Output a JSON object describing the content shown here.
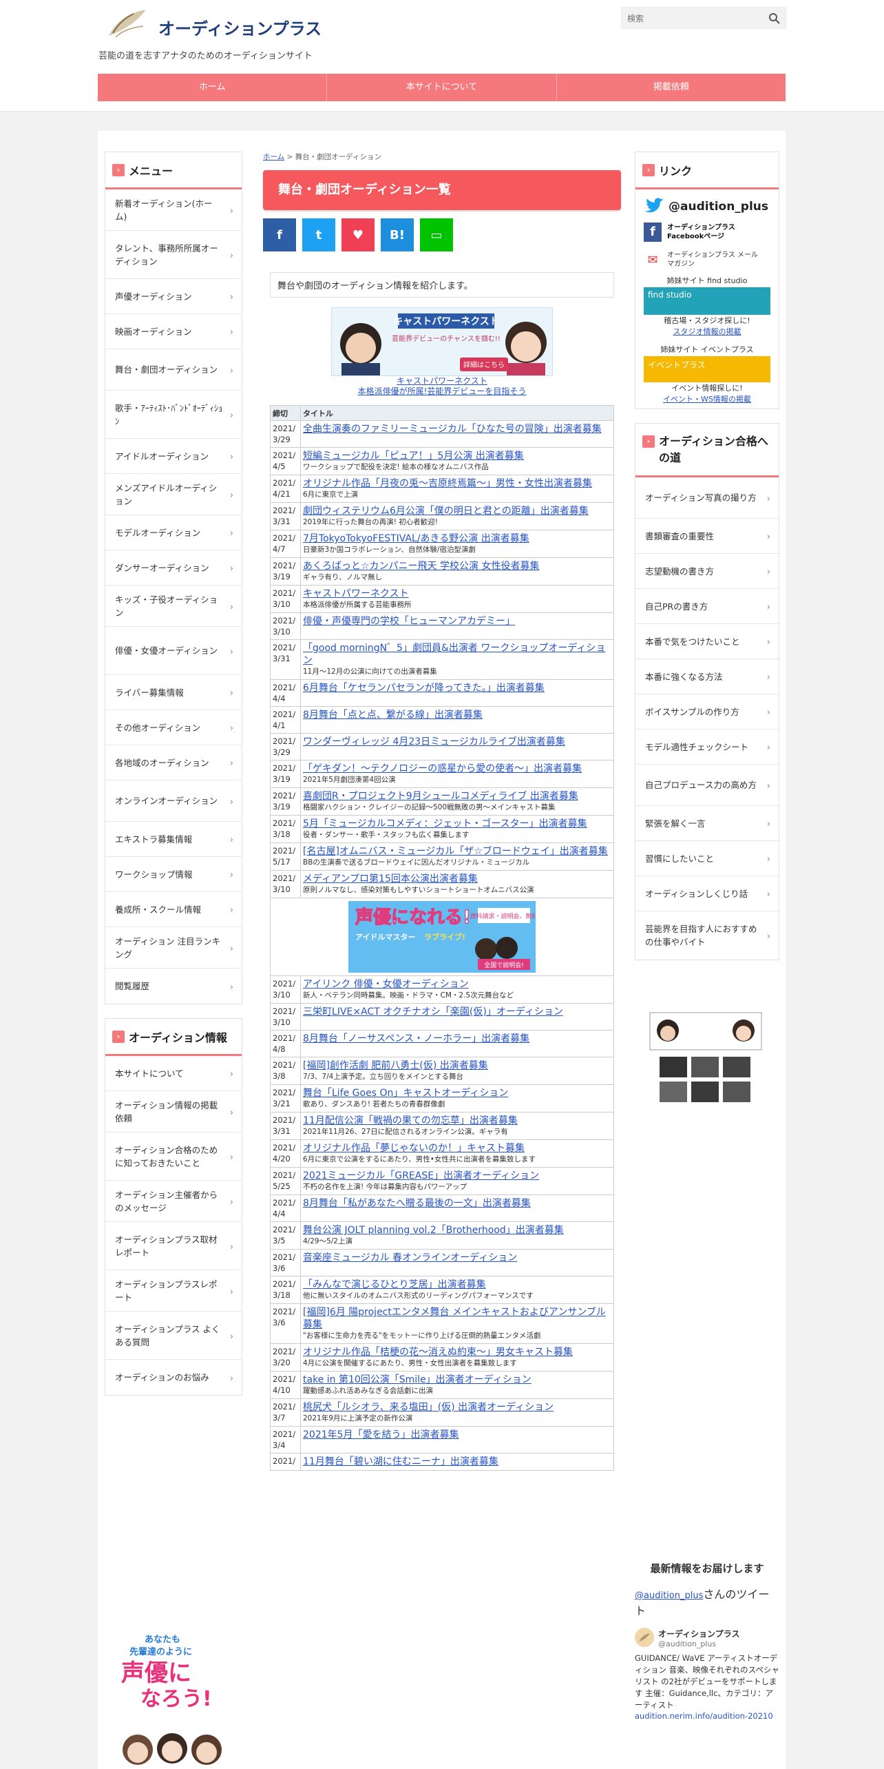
{
  "site": {
    "logo_text": "オーディションプラス",
    "tagline": "芸能の道を志すアナタのためのオーディションサイト",
    "search_placeholder": "検索"
  },
  "nav": [
    "ホーム",
    "本サイトについて",
    "掲載依頼"
  ],
  "breadcrumb": {
    "home": "ホーム",
    "sep": ">",
    "current": "舞台・劇団オーディション"
  },
  "page_title": "舞台・劇団オーディション一覧",
  "share": [
    {
      "name": "facebook",
      "glyph": "f",
      "color": "#2e5fa6"
    },
    {
      "name": "twitter",
      "glyph": "t",
      "color": "#1da1f2"
    },
    {
      "name": "pocket",
      "glyph": "♥",
      "color": "#ef4056"
    },
    {
      "name": "hatena",
      "glyph": "B!",
      "color": "#1e8fdf"
    },
    {
      "name": "line",
      "glyph": "▭",
      "color": "#00c300"
    }
  ],
  "intro": "舞台や劇団のオーディション情報を紹介します。",
  "banner1": {
    "title": "キャストパワーネクスト",
    "sub": "芸能界デビューのチャンスを掴む!!",
    "button": "詳細はこちら",
    "caption1": "キャストパワーネクスト",
    "caption2": "本格派俳優が所属!芸能界デビューを目指そう"
  },
  "table": {
    "col_date": "締切",
    "col_title": "タイトル"
  },
  "jobs": [
    {
      "date": "2021/3/29",
      "title": "全曲生演奏のファミリーミュージカル「ひなた号の冒険」出演者募集",
      "sub": ""
    },
    {
      "date": "2021/4/5",
      "title": "短編ミュージカル「ピュア！」5月公演 出演者募集",
      "sub": "ワークショップで配役を決定! 絵本の様なオムニバス作品"
    },
    {
      "date": "2021/4/21",
      "title": "オリジナル作品「月夜の兎～吉原終焉篇～」男性・女性出演者募集",
      "sub": "6月に東京で上演"
    },
    {
      "date": "2021/3/31",
      "title": "劇団ウィステリウム6月公演「僕の明日と君との距離」出演者募集",
      "sub": "2019年に行った舞台の再演! 初心者歓迎!"
    },
    {
      "date": "2021/4/7",
      "title": "7月TokyoTokyoFESTIVAL/あきる野公演 出演者募集",
      "sub": "日豪新3か国コラボレーション、自然体験/宿泊型演劇"
    },
    {
      "date": "2021/3/19",
      "title": "あくろばっと☆カンパニー飛天 学校公演 女性役者募集",
      "sub": "ギャラ有り、ノルマ無し"
    },
    {
      "date": "2021/3/10",
      "title": "キャストパワーネクスト",
      "sub": "本格派俳優が所属する芸能事務所"
    },
    {
      "date": "2021/3/10",
      "title": "俳優・声優専門の学校「ヒューマンアカデミー」",
      "sub": ""
    },
    {
      "date": "2021/3/31",
      "title": "「good morningN゛5」劇団員&出演者 ワークショップオーディション",
      "sub": "11月～12月の公演に向けての出演者募集"
    },
    {
      "date": "2021/4/4",
      "title": "6月舞台「ケセランパセランが降ってきた。」出演者募集",
      "sub": ""
    },
    {
      "date": "2021/4/1",
      "title": "8月舞台「点と点、繋がる線」出演者募集",
      "sub": ""
    },
    {
      "date": "2021/3/29",
      "title": "ワンダーヴィレッジ 4月23日ミュージカルライブ出演者募集",
      "sub": ""
    },
    {
      "date": "2021/3/19",
      "title": "「ゲキダン！～テクノロジーの惑星から愛の使者～」出演者募集",
      "sub": "2021年5月劇団湊第4回公演"
    },
    {
      "date": "2021/3/19",
      "title": "喜劇団R・プロジェクト9月シュールコメディライブ 出演者募集",
      "sub": "格闘家ハクション・クレイジーの記録～500戦無敗の男～メインキャスト募集"
    },
    {
      "date": "2021/3/18",
      "title": "5月「ミュージカルコメディ：ジェット・ゴースター」出演者募集",
      "sub": "役者・ダンサー・歌手・スタッフも広く募集します"
    },
    {
      "date": "2021/5/17",
      "title": "[名古屋]オムニバス・ミュージカル「ザ☆ブロードウェイ」出演者募集",
      "sub": "BBの生演奏で送るブロードウェイに因んだオリジナル・ミュージカル"
    },
    {
      "date": "2021/3/10",
      "title": "メディアンプロ第15回本公演出演者募集",
      "sub": "原則ノルマなし、感染対策もしやすいショートショートオムニバス公演"
    }
  ],
  "banner2": {
    "line1": "声優になれる!",
    "line2": "資料請求・説明会、無料",
    "line3": "アイドルマスター",
    "line4": "ラブライブ!",
    "line5": "全国で説明会!"
  },
  "jobs2": [
    {
      "date": "2021/3/10",
      "title": "アイリンク 俳優・女優オーディション",
      "sub": "新人・ベテラン同時募集。映画・ドラマ・CM・2.5次元舞台など"
    },
    {
      "date": "2021/3/10",
      "title": "三栄町LIVE×ACT オクチナオシ「楽園(仮)」オーディション",
      "sub": ""
    },
    {
      "date": "2021/4/8",
      "title": "8月舞台「ノーサスペンス・ノーホラー」出演者募集",
      "sub": ""
    },
    {
      "date": "2021/3/8",
      "title": "[福岡]創作活劇 肥前八勇士(仮) 出演者募集",
      "sub": "7/3、7/4上演予定。立ち回りをメインとする舞台"
    },
    {
      "date": "2021/3/21",
      "title": "舞台「Life Goes On」キャストオーディション",
      "sub": "歌あり、ダンスあり! 若者たちの青春群像劇"
    },
    {
      "date": "2021/3/31",
      "title": "11月配信公演「戦禍の果ての勿忘草」出演者募集",
      "sub": "2021年11月26、27日に配信されるオンライン公演。ギャラ有"
    },
    {
      "date": "2021/4/20",
      "title": "オリジナル作品「夢じゃないのか！」キャスト募集",
      "sub": "6月に東京で公演をするにあたり、男性•女性共に出演者を募集致します"
    },
    {
      "date": "2021/5/25",
      "title": "2021ミュージカル「GREASE」出演者オーディション",
      "sub": "不朽の名作を上演! 今年は募集内容もパワーアップ"
    },
    {
      "date": "2021/4/4",
      "title": "8月舞台「私があなたへ贈る最後の一文」出演者募集",
      "sub": ""
    },
    {
      "date": "2021/3/5",
      "title": "舞台公演 JOLT planning vol.2「Brotherhood」出演者募集",
      "sub": "4/29～5/2上演"
    },
    {
      "date": "2021/3/6",
      "title": "音楽座ミュージカル 春オンラインオーディション",
      "sub": ""
    },
    {
      "date": "2021/3/18",
      "title": "「みんなで演じるひとり芝居」出演者募集",
      "sub": "他に無いスタイルのオムニバス形式のリーディングパフォーマンスです"
    },
    {
      "date": "2021/3/6",
      "title": "[福岡]6月 陽projectエンタメ舞台 メインキャストおよびアンサンブル募集",
      "sub": "\"お客様に生命力を売る\"をモットーに作り上げる圧倒的熱量エンタメ活劇"
    },
    {
      "date": "2021/3/20",
      "title": "オリジナル作品「桔梗の花～消えぬ約束～」男女キャスト募集",
      "sub": "4月に公演を開催するにあたり、男性・女性出演者を募集致します"
    },
    {
      "date": "2021/4/10",
      "title": "take in 第10回公演「Smile」出演者オーディション",
      "sub": "躍動感あふれ活あみなぎる会話劇に出演"
    },
    {
      "date": "2021/3/7",
      "title": "桃尻犬「ルシオラ、来る塩田」(仮) 出演者オーディション",
      "sub": "2021年9月に上演予定の新作公演"
    },
    {
      "date": "2021/3/4",
      "title": "2021年5月「愛を結う」出演者募集",
      "sub": ""
    },
    {
      "date": "2021/",
      "title": "11月舞台「碧い湖に住むニーナ」出演者募集",
      "sub": ""
    }
  ],
  "left_menu": {
    "title": "メニュー",
    "items": [
      "新着オーディション(ホーム)",
      "タレント、事務所所属オーディション",
      "声優オーディション",
      "映画オーディション",
      "舞台・劇団オーディション",
      "歌手・ｱｰﾃｨｽﾄ･ﾊﾞﾝﾄﾞｵｰﾃﾞｨｼｮﾝ",
      "アイドルオーディション",
      "メンズアイドルオーディション",
      "モデルオーディション",
      "ダンサーオーディション",
      "キッズ・子役オーディション",
      "俳優・女優オーディション",
      "ライバー募集情報",
      "その他オーディション",
      "各地域のオーディション",
      "オンラインオーディション",
      "エキストラ募集情報",
      "ワークショップ情報",
      "養成所・スクール情報",
      "オーディション 注目ランキング",
      "閲覧履歴"
    ]
  },
  "left_info": {
    "title": "オーディション情報",
    "items": [
      "本サイトについて",
      "オーディション情報の掲載依頼",
      "オーディション合格のために知っておきたいこと",
      "オーディション主催者からのメッセージ",
      "オーディションプラス取材レポート",
      "オーディションプラスレポート",
      "オーディションプラス よくある質問",
      "オーディションのお悩み"
    ]
  },
  "left_ad": {
    "line1": "あなたも",
    "line2": "先輩達のように",
    "line3": "声優に",
    "line4": "なろう!"
  },
  "links": {
    "title": "リンク",
    "twitter_handle": "@audition_plus",
    "fb_label": "オーディションプラス Facebookページ",
    "mail_label": "オーディションプラス メールマガジン",
    "find_title": "姉妹サイト find studio",
    "find_banner": "find studio",
    "find_desc": "稽古場・スタジオ探しに!",
    "find_link": "スタジオ情報の掲載",
    "event_title": "姉妹サイト イベントプラス",
    "event_banner": "イベントプラス",
    "event_desc": "イベント情報探しに!",
    "event_link": "イベント・WS情報の掲載"
  },
  "road": {
    "title": "オーディション合格への道",
    "items": [
      "オーディション写真の撮り方",
      "書類審査の重要性",
      "志望動機の書き方",
      "自己PRの書き方",
      "本番で気をつけたいこと",
      "本番に強くなる方法",
      "ボイスサンプルの作り方",
      "モデル適性チェックシート",
      "自己プロデュース力の高め方",
      "緊張を解く一言",
      "習慣にしたいこと",
      "オーディションしくじり話",
      "芸能界を目指す人におすすめの仕事やバイト"
    ]
  },
  "latest": {
    "title": "最新情報をお届けします",
    "tweet_by": "@audition_plus",
    "tweet_by_suffix": "さんのツイート",
    "account_name": "オーディションプラス",
    "account_handle": "@audition_plus",
    "tweet_text": "GUIDANCE/ WaVE アーティストオーディション 音楽、映像それぞれのスペシャリスト の2社がデビューをサポートします 主催：Guidance,llc、カテゴリ：アーティスト",
    "tweet_link": "audition.nerim.info/audition-20210"
  }
}
